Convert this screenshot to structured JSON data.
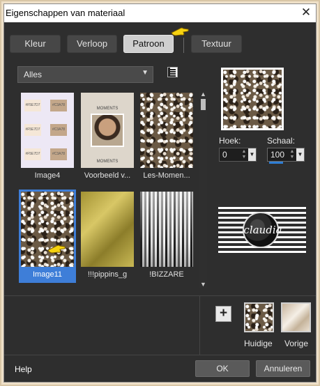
{
  "window": {
    "title": "Eigenschappen van materiaal",
    "close_glyph": "✕"
  },
  "tabs": [
    {
      "label": "Kleur",
      "active": false
    },
    {
      "label": "Verloop",
      "active": false
    },
    {
      "label": "Patroon",
      "active": true
    },
    {
      "label": "Textuur",
      "active": false
    }
  ],
  "category_select": {
    "value": "Alles",
    "icon": "chevron-down-icon"
  },
  "list_view_icon": "list-view-icon",
  "thumbnails": [
    {
      "caption": "Image4",
      "selected": false,
      "kind": "color-swatches",
      "swatch_codes": [
        "#F5E7D7",
        "#C3A78",
        "#F5E7D7",
        "#C3A78",
        "#F5E7D7",
        "#C3A78"
      ]
    },
    {
      "caption": "Voorbeeld v...",
      "selected": false,
      "kind": "moments-preview",
      "labels": [
        "MOMENTS",
        "MOMENTS"
      ]
    },
    {
      "caption": "Les-Momen...",
      "selected": false,
      "kind": "sparkle-pattern"
    },
    {
      "caption": "Image11",
      "selected": true,
      "kind": "sparkle-pattern"
    },
    {
      "caption": "!!!pippins_g",
      "selected": false,
      "kind": "gold-gradient"
    },
    {
      "caption": "!BIZZARE",
      "selected": false,
      "kind": "bizzare-pattern"
    }
  ],
  "hoek": {
    "label": "Hoek:",
    "value": "0"
  },
  "schaal": {
    "label": "Schaal:",
    "value": "100"
  },
  "logo": {
    "text": "claudia"
  },
  "swatches": {
    "huidige_label": "Huidige",
    "vorige_label": "Vorige",
    "add_glyph": "+"
  },
  "footer": {
    "help": "Help",
    "ok": "OK",
    "cancel": "Annuleren"
  },
  "colors": {
    "window_bg": "#2e2e2e",
    "selection": "#3e7ed8",
    "frame": "#efe0c8"
  }
}
